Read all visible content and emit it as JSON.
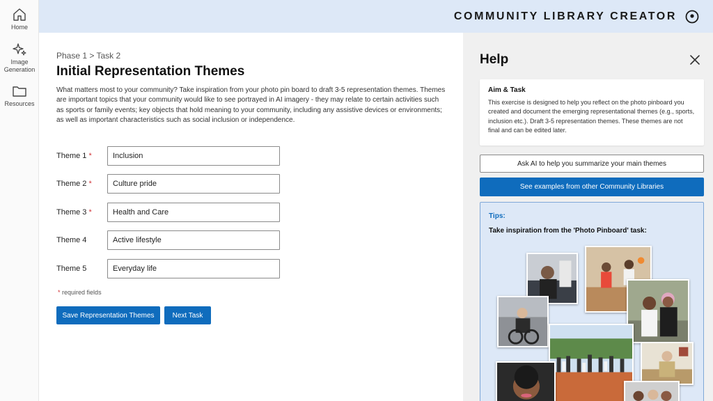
{
  "nav": {
    "items": [
      {
        "label": "Home",
        "icon": "home-icon"
      },
      {
        "label": "Image Generation",
        "icon": "sparkle-icon"
      },
      {
        "label": "Resources",
        "icon": "folder-icon"
      }
    ]
  },
  "header": {
    "title": "COMMUNITY LIBRARY CREATOR",
    "profile_icon": "profile-icon"
  },
  "main": {
    "breadcrumb": "Phase 1 > Task 2",
    "title": "Initial Representation Themes",
    "description": "What matters most to your community? Take inspiration from your photo pin board to draft 3-5 representation themes. Themes are important topics that your community would like to see portrayed in AI imagery - they may relate to certain activities such as sports or family events; key objects that hold meaning to your community, including any assistive devices or environments; as well as important characteristics such as social inclusion or independence.",
    "themes": [
      {
        "label": "Theme 1",
        "required": true,
        "value": "Inclusion"
      },
      {
        "label": "Theme 2",
        "required": true,
        "value": "Culture pride"
      },
      {
        "label": "Theme 3",
        "required": true,
        "value": "Health and Care"
      },
      {
        "label": "Theme 4",
        "required": false,
        "value": "Active lifestyle"
      },
      {
        "label": "Theme 5",
        "required": false,
        "value": "Everyday life"
      }
    ],
    "required_star": "*",
    "required_note": "required fields",
    "save_button": "Save Representation Themes",
    "next_button": "Next Task"
  },
  "help": {
    "title": "Help",
    "aim_heading": "Aim & Task",
    "aim_text": "This exercise is designed to help you reflect on the photo pinboard you created and document the emerging representational themes (e.g., sports, inclusion etc.). Draft 3-5 representation themes. These themes are not final and can be edited later.",
    "ask_ai_button": "Ask AI to help you summarize your main themes",
    "examples_button": "See examples from other Community Libraries",
    "tips_label": "Tips:",
    "tips_text": "Take inspiration from the 'Photo Pinboard' task:"
  },
  "colors": {
    "accent": "#0f6cbd",
    "header_bg": "#dde8f7",
    "required": "#d13438",
    "panel_bg": "#f0f0f0"
  }
}
